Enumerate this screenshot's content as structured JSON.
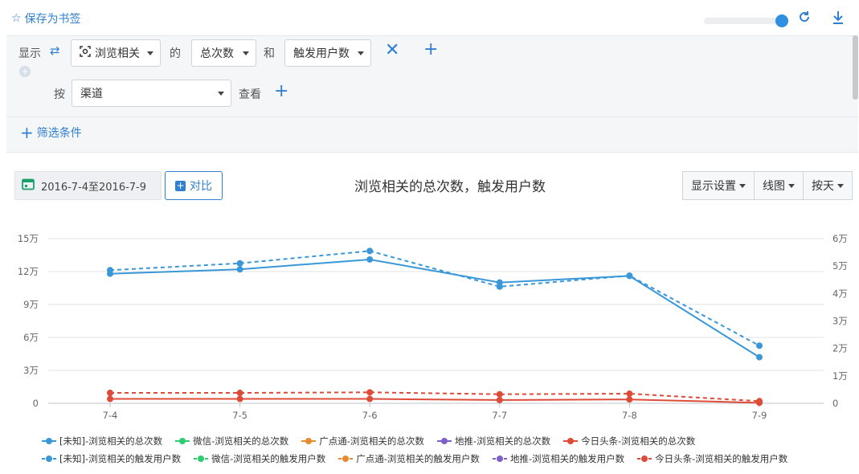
{
  "topbar": {
    "bookmark_label": "保存为书签",
    "slider_value": 0.97
  },
  "query": {
    "show_label": "显示",
    "event": "浏览相关",
    "of_label": "的",
    "metric": "总次数",
    "and_label": "和",
    "metric2": "触发用户数",
    "by_label": "按",
    "group_by": "渠道",
    "view_label": "查看",
    "filter_label": "筛选条件"
  },
  "toolbar": {
    "date_range": "2016-7-4至2016-7-9",
    "compare_label": "对比",
    "display_settings": "显示设置",
    "chart_type": "线图",
    "granularity": "按天"
  },
  "colors": {
    "blue": "#3a97d8",
    "green": "#2ecc71",
    "orange": "#e98a2c",
    "purple": "#7f5fc9",
    "red": "#dd4b39"
  },
  "chart_data": {
    "type": "line",
    "title": "浏览相关的总次数，触发用户数",
    "categories": [
      "7-4",
      "7-5",
      "7-6",
      "7-7",
      "7-8",
      "7-9"
    ],
    "y_left": {
      "ticks": [
        "0",
        "3万",
        "6万",
        "9万",
        "12万",
        "15万"
      ],
      "min": 0,
      "max": 150000
    },
    "y_right": {
      "ticks": [
        "0",
        "1万",
        "2万",
        "3万",
        "4万",
        "5万",
        "6万"
      ],
      "min": 0,
      "max": 60000
    },
    "series": [
      {
        "name": "[未知]-浏览相关的总次数",
        "color": "blue",
        "axis": "left",
        "dash": false,
        "values": [
          118000,
          122000,
          131000,
          110000,
          116000,
          42000
        ]
      },
      {
        "name": "微信-浏览相关的总次数",
        "color": "green",
        "axis": "left",
        "dash": false,
        "values": []
      },
      {
        "name": "广点通-浏览相关的总次数",
        "color": "orange",
        "axis": "left",
        "dash": false,
        "values": []
      },
      {
        "name": "地推-浏览相关的总次数",
        "color": "purple",
        "axis": "left",
        "dash": false,
        "values": []
      },
      {
        "name": "今日头条-浏览相关的总次数",
        "color": "red",
        "axis": "left",
        "dash": false,
        "values": [
          4000,
          4000,
          4000,
          3000,
          3500,
          500
        ]
      },
      {
        "name": "[未知]-浏览相关的触发用户数",
        "color": "blue",
        "axis": "right",
        "dash": true,
        "values": [
          48500,
          51000,
          55500,
          42500,
          46500,
          21000
        ]
      },
      {
        "name": "微信-浏览相关的触发用户数",
        "color": "green",
        "axis": "right",
        "dash": true,
        "values": []
      },
      {
        "name": "广点通-浏览相关的触发用户数",
        "color": "orange",
        "axis": "right",
        "dash": true,
        "values": []
      },
      {
        "name": "地推-浏览相关的触发用户数",
        "color": "purple",
        "axis": "right",
        "dash": true,
        "values": []
      },
      {
        "name": "今日头条-浏览相关的触发用户数",
        "color": "red",
        "axis": "right",
        "dash": true,
        "values": [
          3800,
          3800,
          4000,
          3300,
          3500,
          800
        ]
      }
    ]
  }
}
